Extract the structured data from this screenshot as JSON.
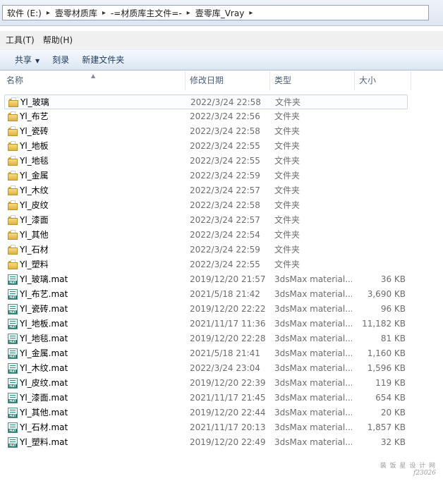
{
  "address_bar": {
    "segments": [
      "软件 (E:)",
      "壹零材质库",
      "-=材质库主文件=-",
      "壹零库_Vray"
    ],
    "separator": "▸"
  },
  "menu": {
    "tools": "工具(T)",
    "help": "帮助(H)"
  },
  "toolbar": {
    "share": "共享",
    "burn": "刻录",
    "new_folder": "新建文件夹"
  },
  "columns": {
    "name": "名称",
    "date": "修改日期",
    "type": "类型",
    "size": "大小"
  },
  "files": [
    {
      "name": "Yl_玻璃",
      "date": "2022/3/24 22:58",
      "type": "文件夹",
      "size": "",
      "kind": "folder"
    },
    {
      "name": "Yl_布艺",
      "date": "2022/3/24 22:56",
      "type": "文件夹",
      "size": "",
      "kind": "folder"
    },
    {
      "name": "Yl_瓷砖",
      "date": "2022/3/24 22:58",
      "type": "文件夹",
      "size": "",
      "kind": "folder"
    },
    {
      "name": "Yl_地板",
      "date": "2022/3/24 22:55",
      "type": "文件夹",
      "size": "",
      "kind": "folder"
    },
    {
      "name": "Yl_地毯",
      "date": "2022/3/24 22:55",
      "type": "文件夹",
      "size": "",
      "kind": "folder"
    },
    {
      "name": "Yl_金属",
      "date": "2022/3/24 22:59",
      "type": "文件夹",
      "size": "",
      "kind": "folder"
    },
    {
      "name": "Yl_木纹",
      "date": "2022/3/24 22:57",
      "type": "文件夹",
      "size": "",
      "kind": "folder"
    },
    {
      "name": "Yl_皮纹",
      "date": "2022/3/24 22:58",
      "type": "文件夹",
      "size": "",
      "kind": "folder"
    },
    {
      "name": "Yl_漆面",
      "date": "2022/3/24 22:57",
      "type": "文件夹",
      "size": "",
      "kind": "folder"
    },
    {
      "name": "Yl_其他",
      "date": "2022/3/24 22:54",
      "type": "文件夹",
      "size": "",
      "kind": "folder"
    },
    {
      "name": "Yl_石材",
      "date": "2022/3/24 22:59",
      "type": "文件夹",
      "size": "",
      "kind": "folder"
    },
    {
      "name": "Yl_塑料",
      "date": "2022/3/24 22:55",
      "type": "文件夹",
      "size": "",
      "kind": "folder"
    },
    {
      "name": "Yl_玻璃.mat",
      "date": "2019/12/20 21:57",
      "type": "3dsMax material...",
      "size": "36 KB",
      "kind": "mat"
    },
    {
      "name": "Yl_布艺.mat",
      "date": "2021/5/18 21:42",
      "type": "3dsMax material...",
      "size": "3,690 KB",
      "kind": "mat"
    },
    {
      "name": "Yl_瓷砖.mat",
      "date": "2019/12/20 22:22",
      "type": "3dsMax material...",
      "size": "96 KB",
      "kind": "mat"
    },
    {
      "name": "Yl_地板.mat",
      "date": "2021/11/17 11:36",
      "type": "3dsMax material...",
      "size": "11,182 KB",
      "kind": "mat"
    },
    {
      "name": "Yl_地毯.mat",
      "date": "2019/12/20 22:28",
      "type": "3dsMax material...",
      "size": "81 KB",
      "kind": "mat"
    },
    {
      "name": "Yl_金属.mat",
      "date": "2021/5/18 21:41",
      "type": "3dsMax material...",
      "size": "1,160 KB",
      "kind": "mat"
    },
    {
      "name": "Yl_木纹.mat",
      "date": "2022/3/24 23:04",
      "type": "3dsMax material...",
      "size": "1,596 KB",
      "kind": "mat"
    },
    {
      "name": "Yl_皮纹.mat",
      "date": "2019/12/20 22:39",
      "type": "3dsMax material...",
      "size": "119 KB",
      "kind": "mat"
    },
    {
      "name": "Yl_漆面.mat",
      "date": "2021/11/17 21:45",
      "type": "3dsMax material...",
      "size": "654 KB",
      "kind": "mat"
    },
    {
      "name": "Yl_其他.mat",
      "date": "2019/12/20 22:44",
      "type": "3dsMax material...",
      "size": "20 KB",
      "kind": "mat"
    },
    {
      "name": "Yl_石材.mat",
      "date": "2021/11/17 20:13",
      "type": "3dsMax material...",
      "size": "1,857 KB",
      "kind": "mat"
    },
    {
      "name": "Yl_塑料.mat",
      "date": "2019/12/20 22:49",
      "type": "3dsMax material...",
      "size": "32 KB",
      "kind": "mat"
    }
  ],
  "watermark": {
    "line1": "装 饭 星 设 计 网",
    "line2": "f23026"
  },
  "icons": {
    "folder": "folder-icon",
    "mat": "mat-file-icon",
    "dropdown": "chevron-down-icon",
    "sort": "sort-up-icon"
  }
}
